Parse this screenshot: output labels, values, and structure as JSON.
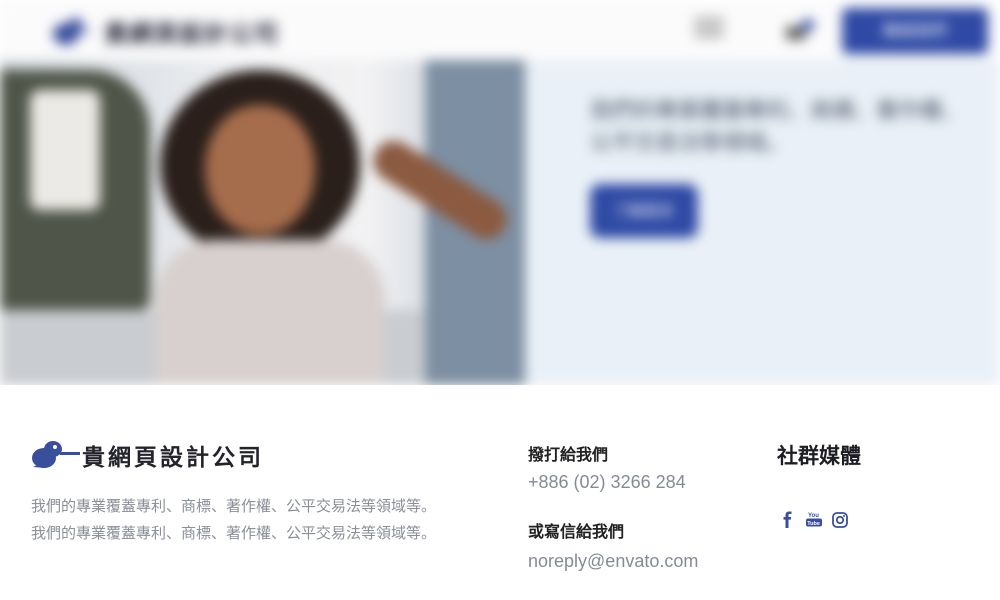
{
  "header": {
    "logo_text": "貴網頁設計公司",
    "cta_label": "聯絡我們"
  },
  "hero": {
    "text": "我們的專業覆蓋專利、商標、著作權、公平交易法等領域。",
    "button_label": "了解更多"
  },
  "footer": {
    "logo_text": "貴網頁設計公司",
    "description": [
      "我們的專業覆蓋專利、商標、著作權、公平交易法等領域等。",
      "我們的專業覆蓋專利、商標、著作權、公平交易法等領域等。"
    ],
    "phone_heading": "撥打給我們",
    "phone_value": "+886 (02) 3266 284",
    "email_heading": "或寫信給我們",
    "email_value": "noreply@envato.com",
    "social_heading": "社群媒體",
    "social_icons": [
      "facebook-icon",
      "youtube-icon",
      "instagram-icon"
    ]
  },
  "colors": {
    "brand_blue": "#2f4aa5",
    "logo_blue": "#3a4f9c",
    "text_gray": "#858b96",
    "heading_dark": "#222222"
  }
}
